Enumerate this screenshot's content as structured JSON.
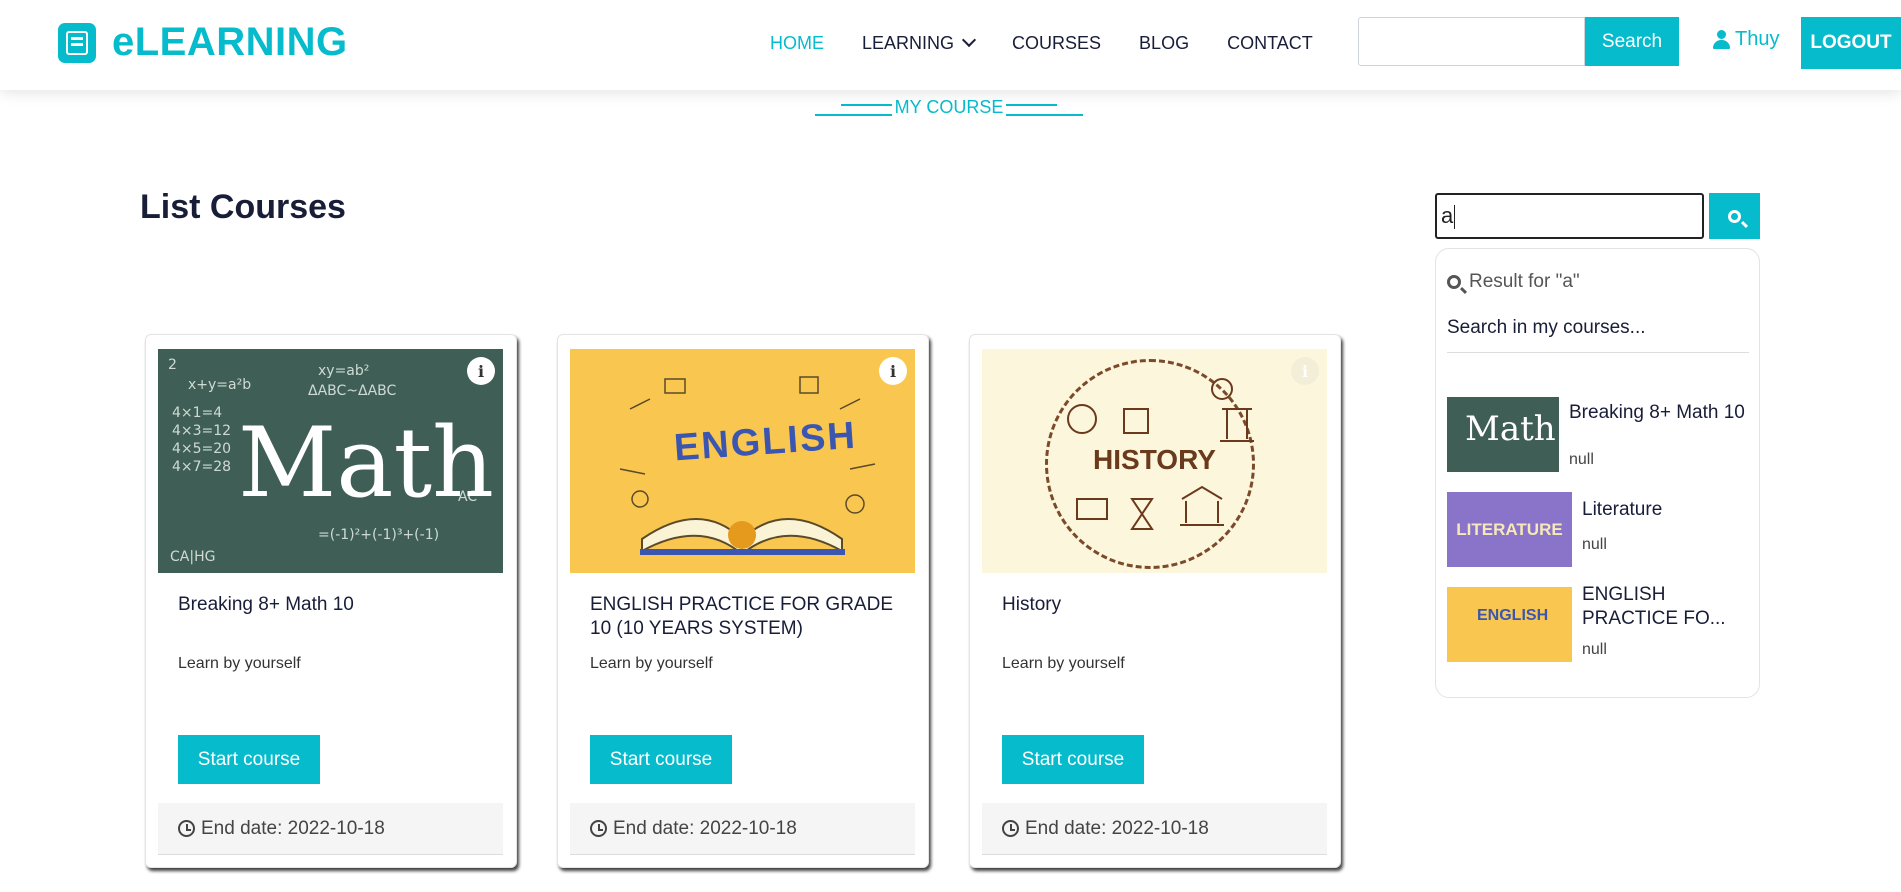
{
  "brand": {
    "name": "eLEARNING",
    "icon": "book-icon"
  },
  "nav": {
    "items": [
      {
        "label": "HOME",
        "active": true
      },
      {
        "label": "LEARNING",
        "dropdown": true
      },
      {
        "label": "COURSES"
      },
      {
        "label": "BLOG"
      },
      {
        "label": "CONTACT"
      }
    ],
    "search_value": "",
    "search_label": "Search",
    "user_name": "Thuy",
    "logout_label": "LOGOUT"
  },
  "section_title": "MY COURSE",
  "page_title": "List Courses",
  "courses": [
    {
      "title": "Breaking 8+ Math 10",
      "subtitle": "Learn by yourself",
      "button": "Start course",
      "end_date": "End date: 2022-10-18",
      "image_text": "Math"
    },
    {
      "title": "ENGLISH PRACTICE FOR GRADE 10 (10 YEARS SYSTEM)",
      "subtitle": "Learn by yourself",
      "button": "Start course",
      "end_date": "End date: 2022-10-18",
      "image_text": "ENGLISH"
    },
    {
      "title": "History",
      "subtitle": "Learn by yourself",
      "button": "Start course",
      "end_date": "End date: 2022-10-18",
      "image_text": "HISTORY"
    }
  ],
  "sidebar": {
    "search_value": "a",
    "result_for": "Result for \"a\"",
    "heading": "Search in my courses...",
    "results": [
      {
        "name": "Breaking 8+ Math 10",
        "value": "null",
        "image_text": "Math"
      },
      {
        "name": "Literature",
        "value": "null",
        "image_text": "LITERATURE"
      },
      {
        "name": "ENGLISH PRACTICE FO...",
        "value": "null",
        "image_text": "ENGLISH"
      }
    ]
  },
  "colors": {
    "accent": "#06bbcc",
    "dark": "#181d38"
  }
}
